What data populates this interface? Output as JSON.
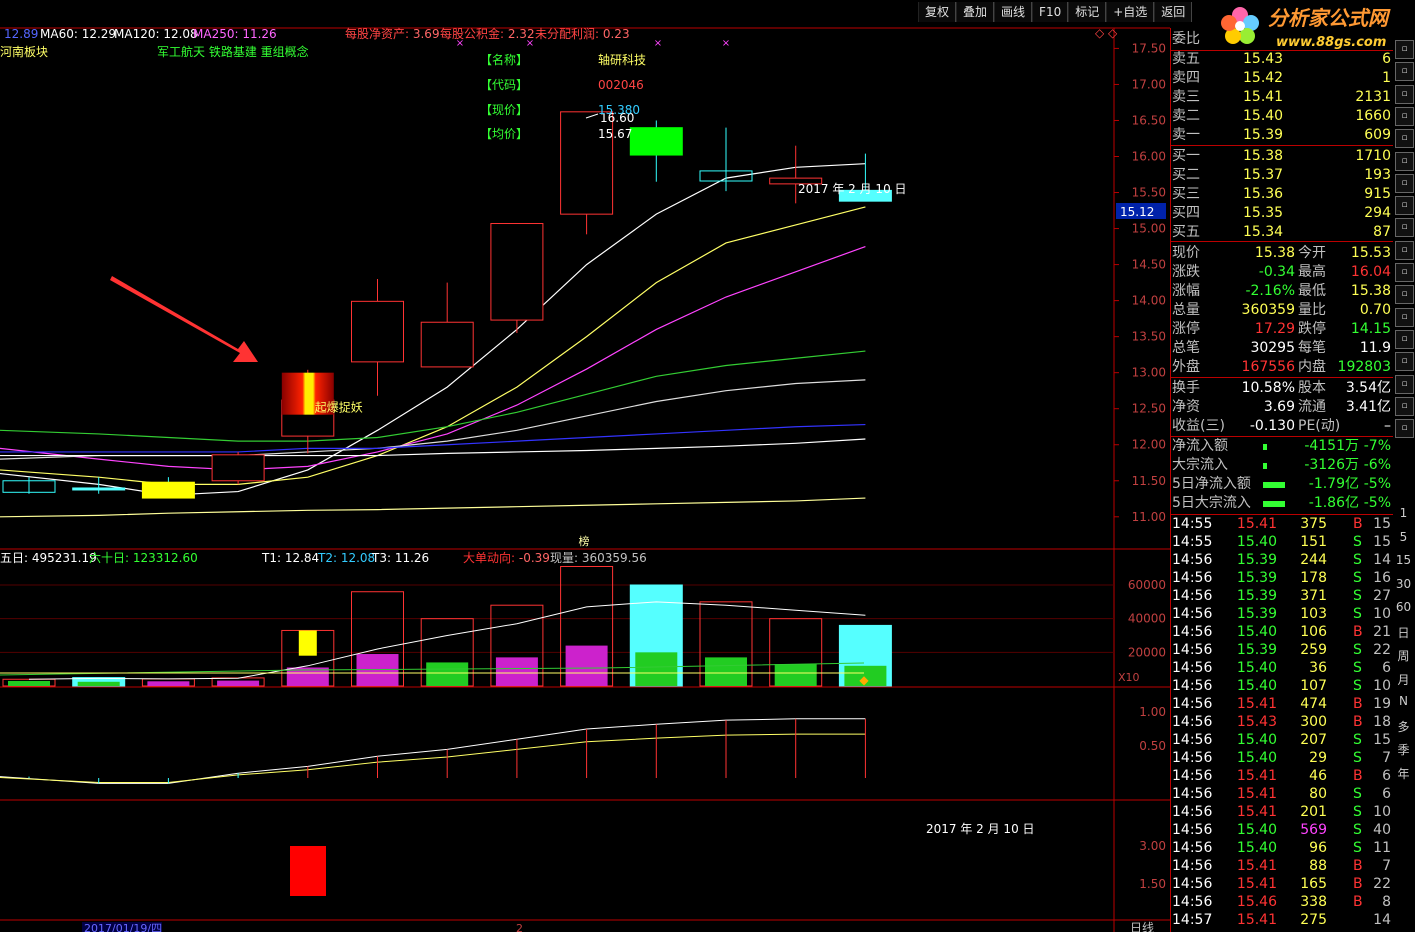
{
  "toolbar": [
    "复权",
    "叠加",
    "画线",
    "F10",
    "标记",
    "+自选",
    "返回"
  ],
  "logo": {
    "cn": "分析家公式网",
    "url": "www.88gs.com"
  },
  "main_header": {
    "ma_partial": "12.89",
    "ma60": "MA60: 12.29",
    "ma120": "MA120: 12.08",
    "ma250": "MA250: 11.26",
    "eps_label": "每股净资产: ",
    "eps_value": "3.69",
    "capfund_label": "每股公积金: ",
    "capfund_value": "2.32",
    "undist_label": "未分配利润: ",
    "undist_value": "0.23",
    "sector": "河南板块",
    "concepts": "军工航天 铁路基建 重组概念"
  },
  "info_box": {
    "name_label": "【名称】",
    "name": "轴研科技",
    "code_label": "【代码】",
    "code": "002046",
    "price_label": "【现价】",
    "price": "15.380",
    "avg_label": "【均价】",
    "avg": "15.67"
  },
  "price_annot": "16.60",
  "date_label_main": "2017 年 2 月 10 日",
  "signal_label": "起爆捉妖",
  "price_tag": "15.12",
  "bang_label": "榜",
  "y_axis_main": [
    "17.50",
    "17.00",
    "16.50",
    "16.00",
    "15.50",
    "15.00",
    "14.50",
    "14.00",
    "13.50",
    "13.00",
    "12.50",
    "12.00",
    "11.50",
    "11.00"
  ],
  "vol_header": {
    "d5": "五日: 495231.19",
    "d60": "六十日: 123312.60",
    "t1": "T1: 12.84",
    "t2": "T2: 12.08",
    "t3": "T3: 11.26",
    "big_label": "大单动向: ",
    "big_value": "-0.39",
    "cur_label": "现量: ",
    "cur_value": "360359.56"
  },
  "y_axis_vol": [
    "60000",
    "40000",
    "20000"
  ],
  "x10": "X10",
  "y_axis_ind": [
    "1.00",
    "0.50"
  ],
  "y_axis_bot": [
    "3.00",
    "1.50"
  ],
  "date_label_bottom": "2017 年 2 月 10 日",
  "bottom_date": "2017/01/19/四",
  "bottom_right": "日线",
  "bottom_num": "2",
  "weibi": "委比",
  "orderbook": [
    {
      "label": "卖五",
      "price": "15.43",
      "vol": "6"
    },
    {
      "label": "卖四",
      "price": "15.42",
      "vol": "1"
    },
    {
      "label": "卖三",
      "price": "15.41",
      "vol": "2131"
    },
    {
      "label": "卖二",
      "price": "15.40",
      "vol": "1660"
    },
    {
      "label": "卖一",
      "price": "15.39",
      "vol": "609"
    },
    {
      "label": "买一",
      "price": "15.38",
      "vol": "1710"
    },
    {
      "label": "买二",
      "price": "15.37",
      "vol": "193"
    },
    {
      "label": "买三",
      "price": "15.36",
      "vol": "915"
    },
    {
      "label": "买四",
      "price": "15.35",
      "vol": "294"
    },
    {
      "label": "买五",
      "price": "15.34",
      "vol": "87"
    }
  ],
  "stats": [
    {
      "l1": "现价",
      "v1": "15.38",
      "c1": "#ffff55",
      "l2": "今开",
      "v2": "15.53",
      "c2": "#ffff55"
    },
    {
      "l1": "涨跌",
      "v1": "-0.34",
      "c1": "#33ff33",
      "l2": "最高",
      "v2": "16.04",
      "c2": "#ff3333"
    },
    {
      "l1": "涨幅",
      "v1": "-2.16%",
      "c1": "#33ff33",
      "l2": "最低",
      "v2": "15.38",
      "c2": "#ffff55"
    },
    {
      "l1": "总量",
      "v1": "360359",
      "c1": "#ffff55",
      "l2": "量比",
      "v2": "0.70",
      "c2": "#ffff55"
    },
    {
      "l1": "涨停",
      "v1": "17.29",
      "c1": "#ff3333",
      "l2": "跌停",
      "v2": "14.15",
      "c2": "#33ff33"
    },
    {
      "l1": "总笔",
      "v1": "30295",
      "c1": "#ffffff",
      "l2": "每笔",
      "v2": "11.9",
      "c2": "#ffffff"
    },
    {
      "l1": "外盘",
      "v1": "167556",
      "c1": "#ff3333",
      "l2": "内盘",
      "v2": "192803",
      "c2": "#33ff33"
    }
  ],
  "stats2": [
    {
      "l1": "换手",
      "v1": "10.58%",
      "l2": "股本",
      "v2": "3.54亿"
    },
    {
      "l1": "净资",
      "v1": "3.69",
      "l2": "流通",
      "v2": "3.41亿"
    },
    {
      "l1": "收益(三)",
      "v1": "-0.130",
      "l2": "PE(动)",
      "v2": "–"
    }
  ],
  "flows": [
    {
      "label": "净流入额",
      "value": "-4151万",
      "pct": "-7%",
      "bar": 0.1
    },
    {
      "label": "大宗流入",
      "value": "-3126万",
      "pct": "-6%",
      "bar": 0.08
    },
    {
      "label": "5日净流入额",
      "value": "-1.79亿",
      "pct": "-5%",
      "bar": 0.9
    },
    {
      "label": "5日大宗流入",
      "value": "-1.86亿",
      "pct": "-5%",
      "bar": 0.9
    }
  ],
  "ticks": [
    {
      "t": "14:55",
      "p": "15.41",
      "v": "375",
      "bs": "B",
      "n": "15"
    },
    {
      "t": "14:55",
      "p": "15.40",
      "v": "151",
      "bs": "S",
      "n": "15"
    },
    {
      "t": "14:56",
      "p": "15.39",
      "v": "244",
      "bs": "S",
      "n": "14"
    },
    {
      "t": "14:56",
      "p": "15.39",
      "v": "178",
      "bs": "S",
      "n": "16"
    },
    {
      "t": "14:56",
      "p": "15.39",
      "v": "371",
      "bs": "S",
      "n": "27"
    },
    {
      "t": "14:56",
      "p": "15.39",
      "v": "103",
      "bs": "S",
      "n": "10"
    },
    {
      "t": "14:56",
      "p": "15.40",
      "v": "106",
      "bs": "B",
      "n": "21"
    },
    {
      "t": "14:56",
      "p": "15.39",
      "v": "259",
      "bs": "S",
      "n": "22"
    },
    {
      "t": "14:56",
      "p": "15.40",
      "v": "36",
      "bs": "S",
      "n": "6"
    },
    {
      "t": "14:56",
      "p": "15.40",
      "v": "107",
      "bs": "S",
      "n": "10"
    },
    {
      "t": "14:56",
      "p": "15.41",
      "v": "474",
      "bs": "B",
      "n": "19"
    },
    {
      "t": "14:56",
      "p": "15.43",
      "v": "300",
      "bs": "B",
      "n": "18"
    },
    {
      "t": "14:56",
      "p": "15.40",
      "v": "207",
      "bs": "S",
      "n": "15"
    },
    {
      "t": "14:56",
      "p": "15.40",
      "v": "29",
      "bs": "S",
      "n": "7"
    },
    {
      "t": "14:56",
      "p": "15.41",
      "v": "46",
      "bs": "B",
      "n": "6"
    },
    {
      "t": "14:56",
      "p": "15.41",
      "v": "80",
      "bs": "S",
      "n": "6"
    },
    {
      "t": "14:56",
      "p": "15.41",
      "v": "201",
      "bs": "S",
      "n": "10"
    },
    {
      "t": "14:56",
      "p": "15.40",
      "v": "569",
      "bs": "S",
      "n": "40",
      "big": true
    },
    {
      "t": "14:56",
      "p": "15.40",
      "v": "96",
      "bs": "S",
      "n": "11"
    },
    {
      "t": "14:56",
      "p": "15.41",
      "v": "88",
      "bs": "B",
      "n": "7"
    },
    {
      "t": "14:56",
      "p": "15.41",
      "v": "165",
      "bs": "B",
      "n": "22"
    },
    {
      "t": "14:56",
      "p": "15.46",
      "v": "338",
      "bs": "B",
      "n": "8"
    },
    {
      "t": "14:57",
      "p": "15.41",
      "v": "275",
      "bs": "",
      "n": "14"
    }
  ],
  "strip_icons": [
    "rpt-icon",
    "page-icon",
    "list-icon",
    "line-chart-icon",
    "bar-chart-icon",
    "candle-icon",
    "k-icon",
    "f10-icon",
    "doc-icon",
    "f1-icon",
    "f2-icon",
    "f3-icon",
    "circle-icon",
    "macd-icon",
    "rsi-icon",
    "refresh-icon",
    "move-icon",
    "pen-icon"
  ],
  "strip_periods": [
    "1",
    "5",
    "15",
    "30",
    "60",
    "日",
    "周",
    "月",
    "N",
    "多",
    "季",
    "年"
  ],
  "chart_data": {
    "type": "candlestick",
    "ylim": [
      10.9,
      17.7
    ],
    "candles": [
      {
        "o": 11.5,
        "c": 11.34,
        "h": 11.55,
        "l": 11.32
      },
      {
        "o": 11.4,
        "c": 11.38,
        "h": 11.55,
        "l": 11.32
      },
      {
        "o": 11.48,
        "c": 11.26,
        "h": 11.55,
        "l": 11.26
      },
      {
        "o": 11.5,
        "c": 11.86,
        "h": 11.9,
        "l": 11.45
      },
      {
        "o": 12.12,
        "c": 12.62,
        "h": 13.04,
        "l": 11.88
      },
      {
        "o": 13.15,
        "c": 13.99,
        "h": 14.3,
        "l": 12.68
      },
      {
        "o": 13.08,
        "c": 13.7,
        "h": 14.25,
        "l": 13.08
      },
      {
        "o": 13.73,
        "c": 15.07,
        "h": 15.07,
        "l": 13.55
      },
      {
        "o": 15.2,
        "c": 16.62,
        "h": 16.62,
        "l": 14.92
      },
      {
        "o": 16.4,
        "c": 16.02,
        "h": 16.5,
        "l": 15.65
      },
      {
        "o": 15.8,
        "c": 15.66,
        "h": 16.4,
        "l": 15.52
      },
      {
        "o": 15.62,
        "c": 15.7,
        "h": 16.15,
        "l": 15.35
      },
      {
        "o": 15.53,
        "c": 15.38,
        "h": 16.04,
        "l": 15.38
      }
    ],
    "ma_series": [
      {
        "name": "MA5",
        "color": "#ffffff",
        "values": [
          11.6,
          11.45,
          11.3,
          11.35,
          11.65,
          12.2,
          12.8,
          13.6,
          14.5,
          15.2,
          15.7,
          15.85,
          15.9
        ]
      },
      {
        "name": "MA10",
        "color": "#ffff66",
        "values": [
          11.65,
          11.55,
          11.45,
          11.45,
          11.55,
          11.85,
          12.25,
          12.8,
          13.5,
          14.25,
          14.8,
          15.05,
          15.3
        ]
      },
      {
        "name": "MA20",
        "color": "#ff44ff",
        "values": [
          11.95,
          11.8,
          11.7,
          11.65,
          11.7,
          11.9,
          12.15,
          12.55,
          13.05,
          13.6,
          14.05,
          14.4,
          14.75
        ]
      },
      {
        "name": "MA60",
        "color": "#33cc33",
        "values": [
          12.2,
          12.15,
          12.1,
          12.05,
          12.05,
          12.1,
          12.25,
          12.45,
          12.7,
          12.95,
          13.1,
          13.2,
          13.3
        ]
      },
      {
        "name": "MA120",
        "color": "#dddddd",
        "values": [
          11.8,
          11.85,
          11.85,
          11.85,
          11.9,
          11.95,
          12.05,
          12.2,
          12.4,
          12.6,
          12.75,
          12.85,
          12.9
        ]
      },
      {
        "name": "MA250",
        "color": "#3333ff",
        "values": [
          11.9,
          11.9,
          11.9,
          11.9,
          11.95,
          11.95,
          12.0,
          12.05,
          12.1,
          12.15,
          12.2,
          12.25,
          12.28
        ]
      },
      {
        "name": "MAX",
        "color": "#ffffff",
        "values": [
          11.85,
          11.85,
          11.85,
          11.85,
          11.85,
          11.85,
          11.88,
          11.9,
          11.92,
          11.95,
          11.98,
          12.02,
          12.08
        ]
      },
      {
        "name": "MAY",
        "color": "#ffff99",
        "values": [
          11.0,
          11.02,
          11.05,
          11.07,
          11.09,
          11.1,
          11.12,
          11.14,
          11.16,
          11.18,
          11.2,
          11.22,
          11.26
        ]
      }
    ],
    "volumes": [
      4000,
      5000,
      4200,
      4800,
      33000,
      56000,
      40000,
      48000,
      71000,
      60000,
      50000,
      40000,
      36000
    ],
    "indicator": [
      0.05,
      -0.05,
      -0.05,
      0.1,
      0.2,
      0.35,
      0.45,
      0.6,
      0.75,
      0.82,
      0.88,
      0.9,
      0.9
    ]
  }
}
